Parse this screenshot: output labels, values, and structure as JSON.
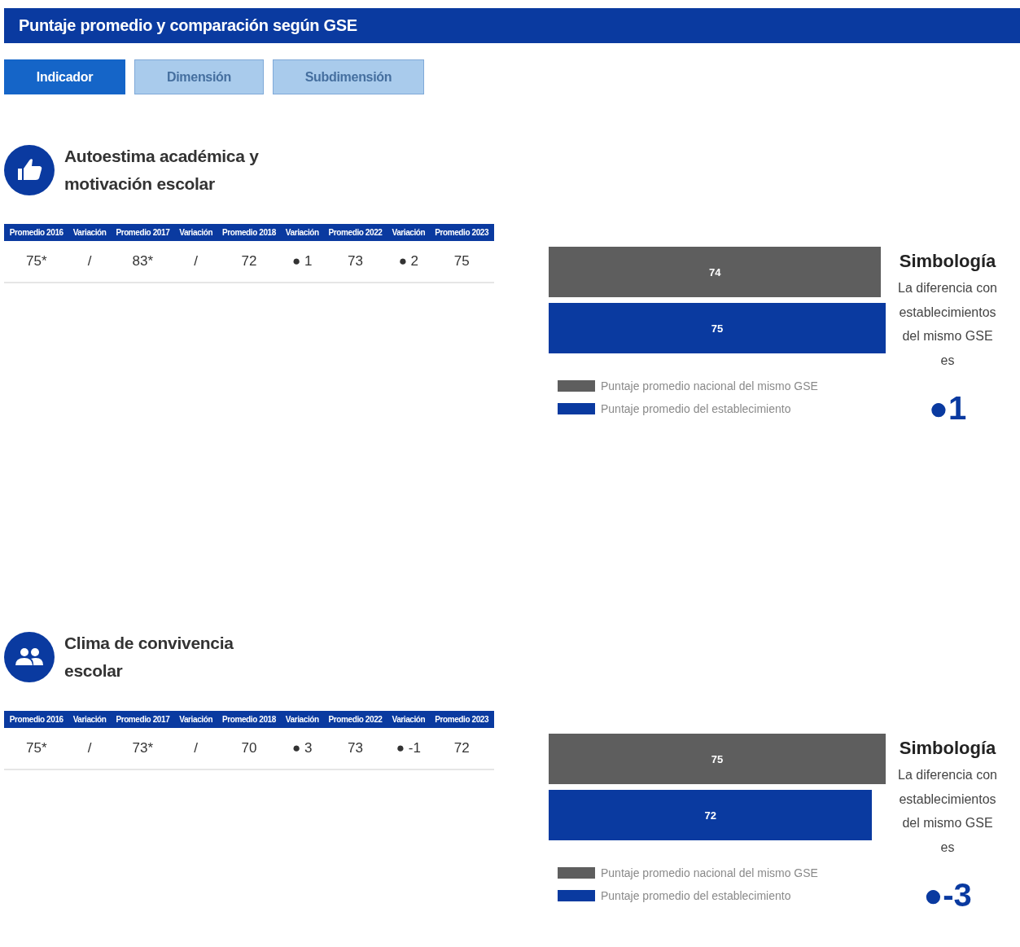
{
  "header": {
    "title": "Puntaje promedio y comparación según GSE"
  },
  "tabs": [
    {
      "label": "Indicador",
      "selected": true
    },
    {
      "label": "Dimensión",
      "selected": false
    },
    {
      "label": "Subdimensión",
      "selected": false
    }
  ],
  "indicators": [
    {
      "title": "Autoestima académica y motivación escolar",
      "table": {
        "columns": [
          "Promedio 2016",
          "Variación",
          "Promedio 2017",
          "Variación",
          "Promedio 2018",
          "Variación",
          "Promedio 2022",
          "Variación",
          "Promedio 2023"
        ],
        "row": [
          "75*",
          "/",
          "83*",
          "/",
          "72",
          "● 1",
          "73",
          "● 2",
          "75"
        ]
      },
      "chart_data": {
        "type": "bar",
        "orientation": "horizontal",
        "data_labels": true,
        "legend": true,
        "series": [
          {
            "name": "Puntaje promedio nacional del mismo GSE",
            "color": "#5e5e5e",
            "values": [
              74
            ]
          },
          {
            "name": "Puntaje promedio del establecimiento",
            "color": "#0a3aa0",
            "values": [
              75
            ]
          }
        ]
      },
      "symbology": {
        "title": "Simbología",
        "text": "La diferencia con establecimientos del mismo GSE es",
        "value": "●1"
      }
    },
    {
      "title": "Clima de convivencia escolar",
      "table": {
        "columns": [
          "Promedio 2016",
          "Variación",
          "Promedio 2017",
          "Variación",
          "Promedio 2018",
          "Variación",
          "Promedio 2022",
          "Variación",
          "Promedio 2023"
        ],
        "row": [
          "75*",
          "/",
          "73*",
          "/",
          "70",
          "● 3",
          "73",
          "● -1",
          "72"
        ]
      },
      "chart_data": {
        "type": "bar",
        "orientation": "horizontal",
        "data_labels": true,
        "legend": true,
        "series": [
          {
            "name": "Puntaje promedio nacional del mismo GSE",
            "color": "#5e5e5e",
            "values": [
              75
            ]
          },
          {
            "name": "Puntaje promedio del establecimiento",
            "color": "#0a3aa0",
            "values": [
              72
            ]
          }
        ]
      },
      "symbology": {
        "title": "Simbología",
        "text": "La diferencia con establecimientos del mismo GSE es",
        "value": "●-3"
      }
    }
  ]
}
